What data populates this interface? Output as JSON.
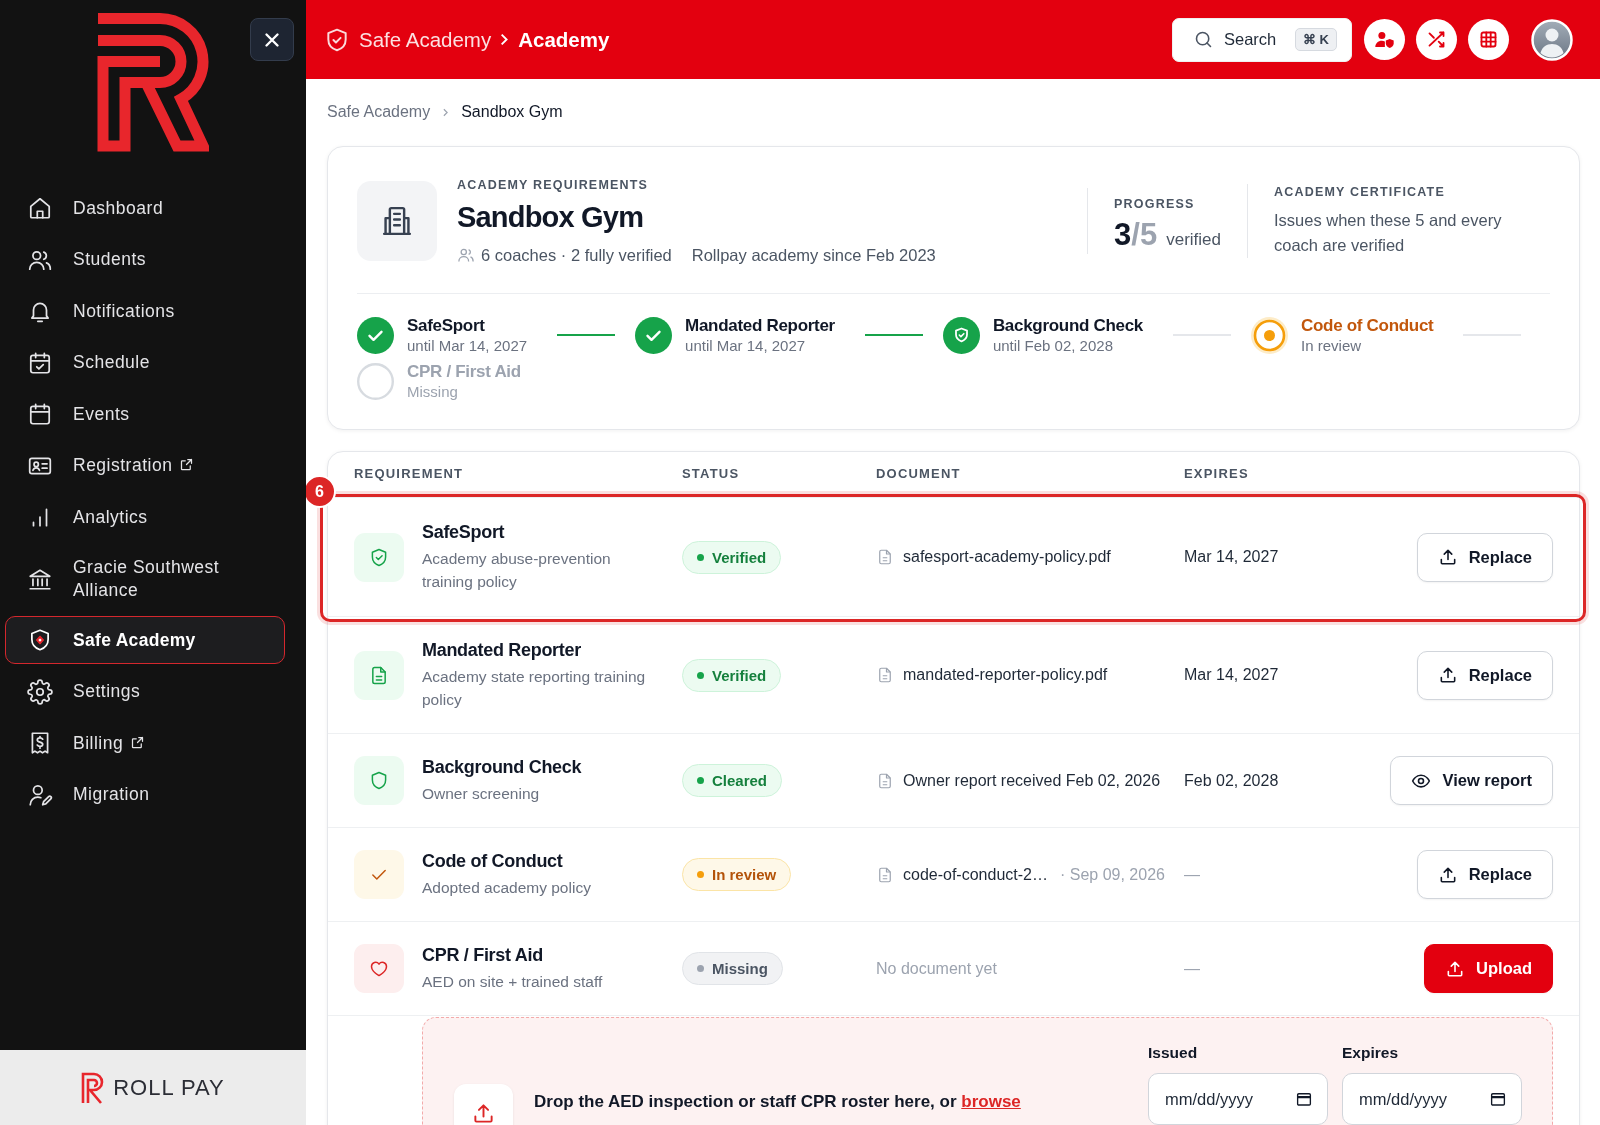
{
  "sidebar": {
    "nav": [
      {
        "label": "Dashboard",
        "external": false,
        "selected": false
      },
      {
        "label": "Students",
        "external": false,
        "selected": false
      },
      {
        "label": "Notifications",
        "external": false,
        "selected": false
      },
      {
        "label": "Schedule",
        "external": false,
        "selected": false
      },
      {
        "label": "Events",
        "external": false,
        "selected": false
      },
      {
        "label": "Registration",
        "external": true,
        "selected": false
      },
      {
        "label": "Analytics",
        "external": false,
        "selected": false
      },
      {
        "label": "Gracie Southwest Alliance",
        "external": false,
        "selected": false
      },
      {
        "label": "Safe Academy",
        "external": false,
        "selected": true
      },
      {
        "label": "Settings",
        "external": false,
        "selected": false
      },
      {
        "label": "Billing",
        "external": true,
        "selected": false
      },
      {
        "label": "Migration",
        "external": false,
        "selected": false
      }
    ],
    "footer_brand": "ROLL PAY"
  },
  "header": {
    "breadcrumb": [
      "Safe Academy",
      "Academy"
    ],
    "search": {
      "label": "Search",
      "shortcut": "⌘ K"
    }
  },
  "breadcrumb": [
    "Safe Academy",
    "Sandbox Gym"
  ],
  "summary": {
    "eyebrow": "ACADEMY REQUIREMENTS",
    "title": "Sandbox Gym",
    "coaches": "6 coaches · 2 fully verified",
    "since": "Rollpay academy since Feb 2023",
    "progress": {
      "label": "PROGRESS",
      "done": "3",
      "total": "/5",
      "unit": "verified"
    },
    "certificate": {
      "label": "ACADEMY CERTIFICATE",
      "text": "Issues when these 5 and every coach are verified"
    },
    "steps": [
      {
        "title": "SafeSport",
        "subtitle": "until Mar 14, 2027",
        "kind": "verified"
      },
      {
        "title": "Mandated Reporter",
        "subtitle": "until Mar 14, 2027",
        "kind": "verified"
      },
      {
        "title": "Background Check",
        "subtitle": "until Feb 02, 2028",
        "kind": "cleared"
      },
      {
        "title": "Code of Conduct",
        "subtitle": "In review",
        "kind": "review"
      },
      {
        "title": "CPR / First Aid",
        "subtitle": "Missing",
        "kind": "missing"
      }
    ]
  },
  "table": {
    "columns": [
      "REQUIREMENT",
      "STATUS",
      "DOCUMENT",
      "EXPIRES"
    ],
    "rows": [
      {
        "title": "SafeSport",
        "description": "Academy abuse-prevention training policy",
        "kind": "verified",
        "status_label": "Verified",
        "document": {
          "kind": "file",
          "name": "safesport-academy-policy.pdf"
        },
        "expires": "Mar 14, 2027",
        "action": {
          "kind": "replace",
          "label": "Replace"
        },
        "callout": "6"
      },
      {
        "title": "Mandated Reporter",
        "description": "Academy state reporting training policy",
        "kind": "verified",
        "status_label": "Verified",
        "document": {
          "kind": "file",
          "name": "mandated-reporter-policy.pdf"
        },
        "expires": "Mar 14, 2027",
        "action": {
          "kind": "replace",
          "label": "Replace"
        }
      },
      {
        "title": "Background Check",
        "description": "Owner screening",
        "kind": "cleared",
        "status_label": "Cleared",
        "document": {
          "kind": "file",
          "name": "Owner report received Feb 02, 2026"
        },
        "expires": "Feb 02, 2028",
        "action": {
          "kind": "view",
          "label": "View report"
        }
      },
      {
        "title": "Code of Conduct",
        "description": "Adopted academy policy",
        "kind": "review",
        "status_label": "In review",
        "document": {
          "kind": "file",
          "name": "code-of-conduct-2…",
          "date": "· Sep 09, 2026"
        },
        "expires": "—",
        "action": {
          "kind": "replace",
          "label": "Replace"
        }
      },
      {
        "title": "CPR / First Aid",
        "description": "AED on site + trained staff",
        "kind": "missing",
        "status_label": "Missing",
        "document": {
          "kind": "none",
          "name": "No document yet"
        },
        "expires": "—",
        "action": {
          "kind": "upload",
          "label": "Upload"
        }
      }
    ],
    "dropzone": {
      "text": "Drop the AED inspection or staff CPR roster here, or",
      "link": "browse",
      "fields": [
        {
          "label": "Issued",
          "placeholder": "mm/dd/yyyy"
        },
        {
          "label": "Expires",
          "placeholder": "mm/dd/yyyy"
        }
      ]
    }
  }
}
